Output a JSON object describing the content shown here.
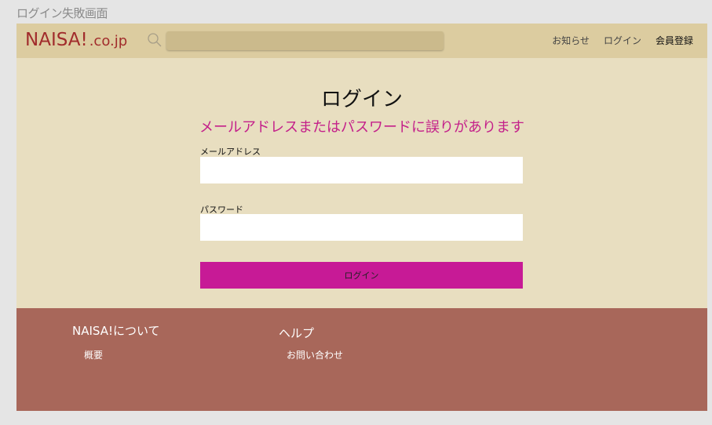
{
  "frame_label": "ログイン失敗画面",
  "header": {
    "logo_main": "NAISA!",
    "logo_domain": ".co.jp",
    "search_icon": "search-icon",
    "search_placeholder": "",
    "nav": {
      "news": "お知らせ",
      "login": "ログイン",
      "register": "会員登録"
    }
  },
  "main": {
    "title": "ログイン",
    "error_message": "メールアドレスまたはパスワードに誤りがあります",
    "email_label": "メールアドレス",
    "email_value": "",
    "password_label": "パスワード",
    "password_value": "",
    "login_button": "ログイン"
  },
  "footer": {
    "about_heading": "NAISA!について",
    "about_link": "概要",
    "help_heading": "ヘルプ",
    "help_link": "お問い合わせ"
  },
  "colors": {
    "header_bg": "#dccca0",
    "page_bg": "#e8dec0",
    "logo": "#a12c2c",
    "error": "#c4208a",
    "button": "#c71a96",
    "footer_bg": "#a8675a"
  }
}
